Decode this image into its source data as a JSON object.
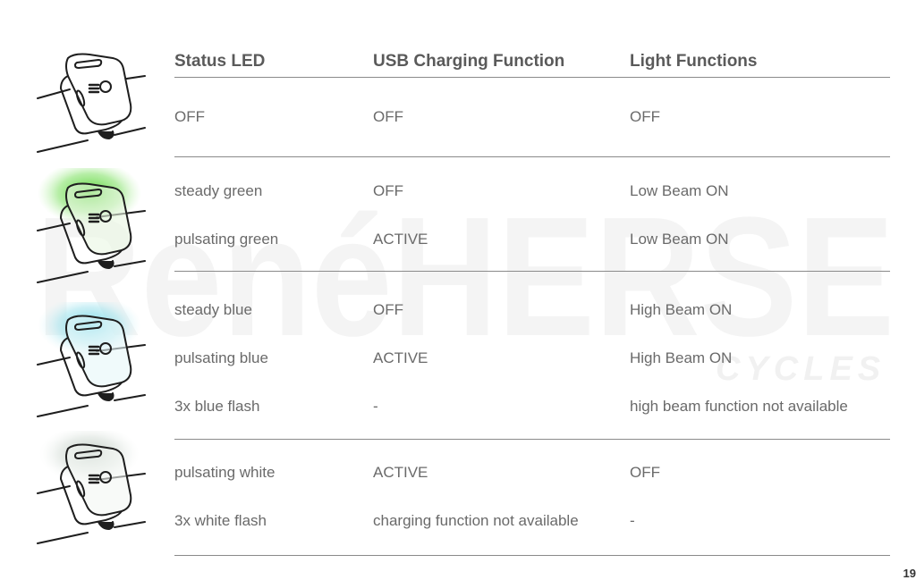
{
  "header": {
    "status_led": "Status LED",
    "usb_charging": "USB Charging Function",
    "light_functions": "Light Functions"
  },
  "groups": [
    {
      "led_color": "none",
      "rows": [
        {
          "status": "OFF",
          "usb": "OFF",
          "light": "OFF"
        }
      ]
    },
    {
      "led_color": "#5ad13a",
      "rows": [
        {
          "status": "steady green",
          "usb": "OFF",
          "light": "Low Beam ON"
        },
        {
          "status": "pulsating green",
          "usb": "ACTIVE",
          "light": "Low Beam ON"
        }
      ]
    },
    {
      "led_color": "#6fd6e6",
      "rows": [
        {
          "status": "steady blue",
          "usb": "OFF",
          "light": "High Beam ON"
        },
        {
          "status": "pulsating blue",
          "usb": "ACTIVE",
          "light": "High Beam ON"
        },
        {
          "status": "3x blue flash",
          "usb": "-",
          "light": "high beam function not available"
        }
      ]
    },
    {
      "led_color": "#c9d2cc",
      "rows": [
        {
          "status": "pulsating white",
          "usb": "ACTIVE",
          "light": "OFF"
        },
        {
          "status": "3x white flash",
          "usb": "charging function not available",
          "light": "-"
        }
      ]
    }
  ],
  "watermark": {
    "brand": "RenéHERSE",
    "sub": "CYCLES"
  },
  "page_number": "19"
}
